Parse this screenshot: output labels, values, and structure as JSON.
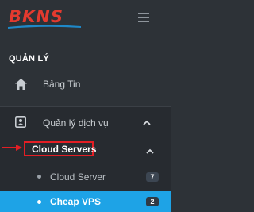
{
  "header": {
    "logo_text": "BKNS",
    "menu_icon": "hamburger-icon"
  },
  "sidebar": {
    "section_title": "QUẢN LÝ",
    "items": [
      {
        "label": "Bảng Tin",
        "icon": "home-icon"
      },
      {
        "label": "Quản lý dịch vụ",
        "icon": "id-card-icon",
        "expanded": true
      }
    ],
    "subgroup": {
      "label": "Cloud Servers",
      "expanded": true,
      "items": [
        {
          "label": "Cloud Server",
          "badge": "7",
          "active": false
        },
        {
          "label": "Cheap VPS",
          "badge": "2",
          "active": true
        }
      ]
    }
  },
  "colors": {
    "sidebar_bg": "#2d3237",
    "active_bg": "#1ea3e6",
    "annotation": "#e31e24",
    "logo": "#e33a2f"
  }
}
